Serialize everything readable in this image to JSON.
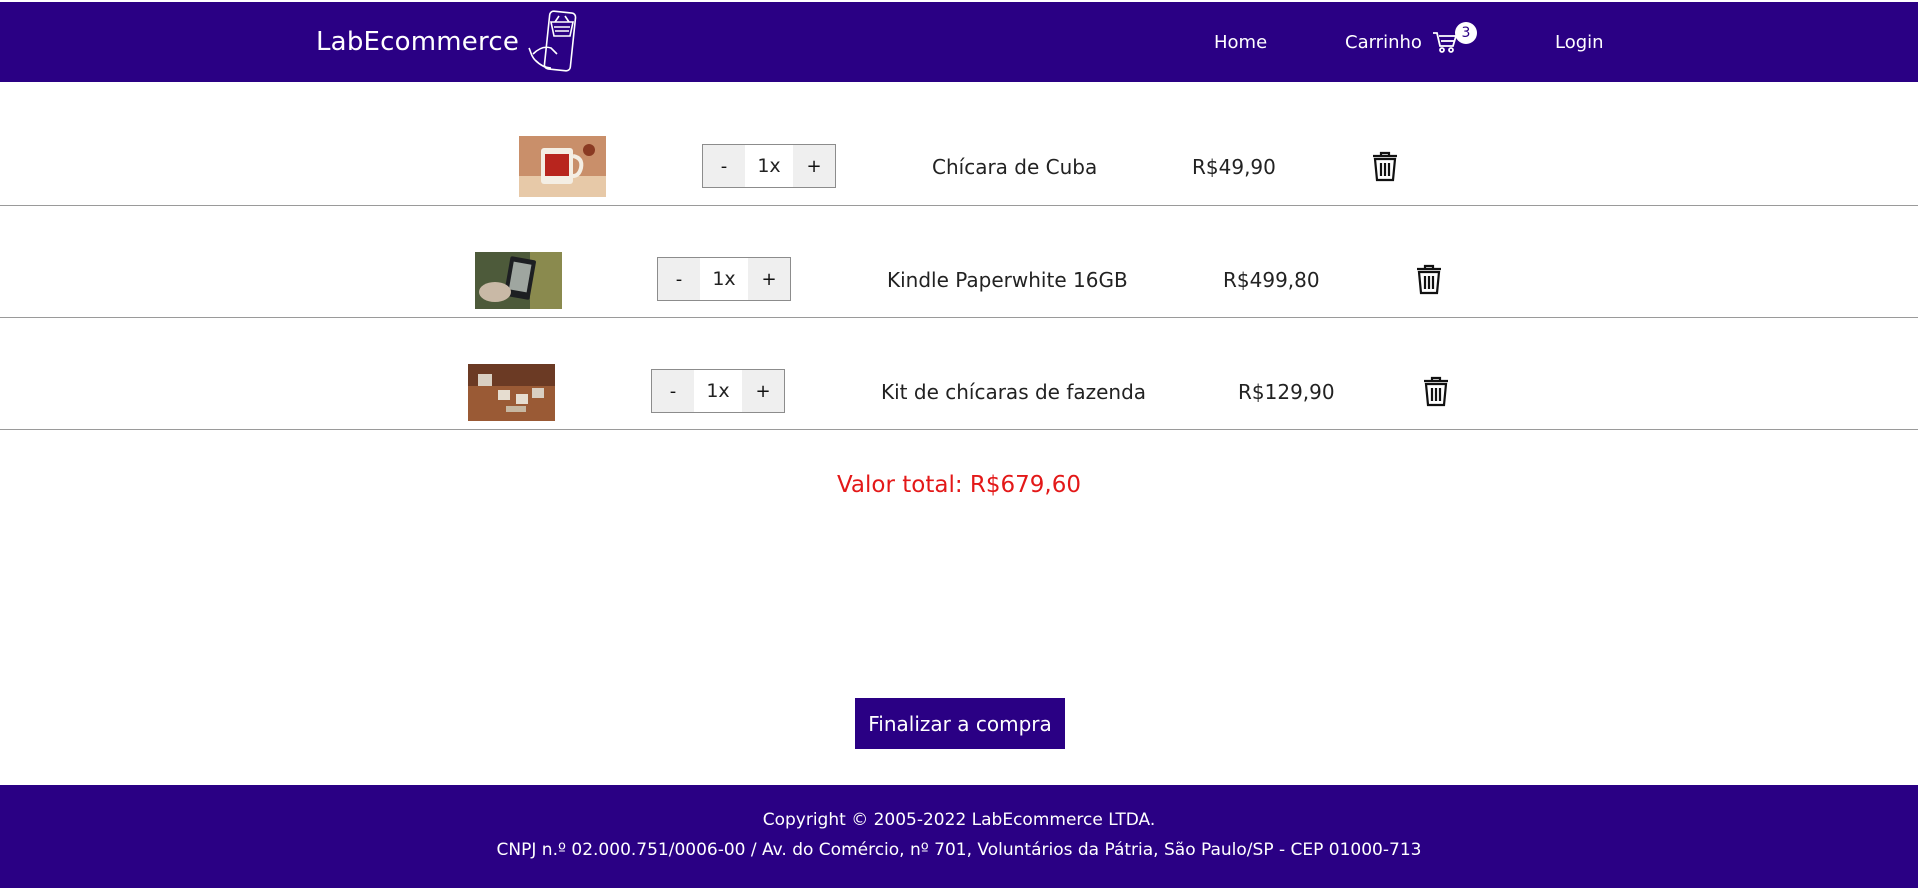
{
  "header": {
    "brand": "LabEcommerce",
    "nav": {
      "home": "Home",
      "cart": "Carrinho",
      "cart_count": "3",
      "login": "Login"
    }
  },
  "cart": {
    "items": [
      {
        "name": "Chícara de Cuba",
        "qty": "1x",
        "price": "R$49,90",
        "minus": "-",
        "plus": "+"
      },
      {
        "name": "Kindle Paperwhite 16GB",
        "qty": "1x",
        "price": "R$499,80",
        "minus": "-",
        "plus": "+"
      },
      {
        "name": "Kit de chícaras de fazenda",
        "qty": "1x",
        "price": "R$129,90",
        "minus": "-",
        "plus": "+"
      }
    ],
    "total": "Valor total: R$679,60",
    "checkout_label": "Finalizar a compra"
  },
  "footer": {
    "line1": "Copyright © 2005-2022 LabEcommerce LTDA.",
    "line2": "CNPJ n.º 02.000.751/0006-00 / Av. do Comércio, nº 701, Voluntários da Pátria, São Paulo/SP - CEP 01000-713"
  },
  "colors": {
    "brand": "#2a0084",
    "total": "#e31818"
  },
  "icons": {
    "logo": "shopping-basket-phone-icon",
    "cart": "cart-icon",
    "delete": "trash-icon"
  }
}
